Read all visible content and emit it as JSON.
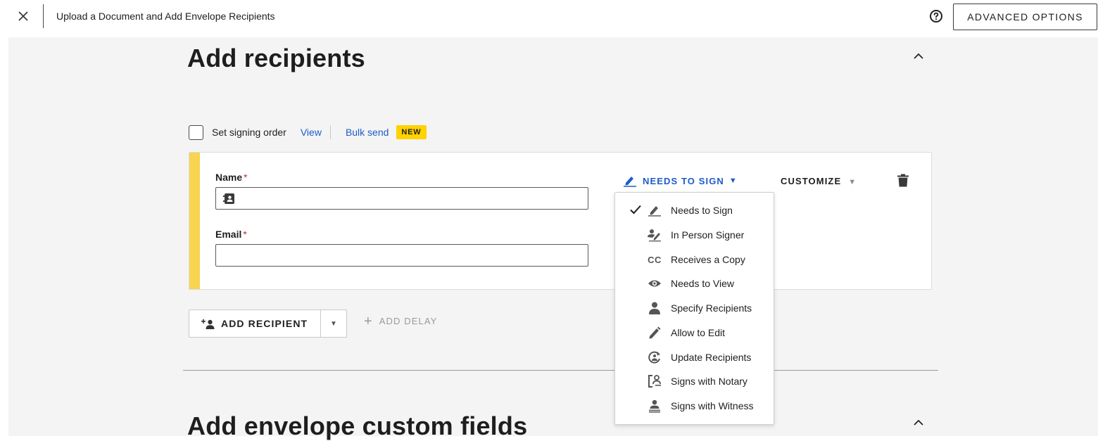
{
  "header": {
    "title": "Upload a Document and Add Envelope Recipients",
    "advanced_options_label": "ADVANCED OPTIONS"
  },
  "recipients_section": {
    "title": "Add recipients",
    "signing_order_label": "Set signing order",
    "view_link": "View",
    "bulk_send_link": "Bulk send",
    "new_badge": "NEW",
    "card": {
      "accent_color": "#f8d451",
      "name_label": "Name",
      "email_label": "Email",
      "required_mark": "*",
      "name_value": "",
      "email_value": "",
      "action_label": "NEEDS TO SIGN",
      "customize_label": "CUSTOMIZE"
    },
    "add_recipient_label": "ADD RECIPIENT",
    "add_delay_label": "ADD DELAY"
  },
  "action_menu": {
    "selected_index": 0,
    "items": [
      {
        "label": "Needs to Sign",
        "icon": "pen-icon"
      },
      {
        "label": "In Person Signer",
        "icon": "in-person-signer-icon"
      },
      {
        "label": "Receives a Copy",
        "icon": "cc-icon"
      },
      {
        "label": "Needs to View",
        "icon": "eye-icon"
      },
      {
        "label": "Specify Recipients",
        "icon": "person-icon"
      },
      {
        "label": "Allow to Edit",
        "icon": "pencil-icon"
      },
      {
        "label": "Update Recipients",
        "icon": "update-recipient-icon"
      },
      {
        "label": "Signs with Notary",
        "icon": "notary-icon"
      },
      {
        "label": "Signs with Witness",
        "icon": "witness-icon"
      }
    ]
  },
  "custom_fields_section": {
    "title": "Add envelope custom fields"
  },
  "colors": {
    "link": "#1d5cc9",
    "badge": "#ffd200",
    "required": "#c42b2b",
    "canvas": "#f4f4f4"
  }
}
